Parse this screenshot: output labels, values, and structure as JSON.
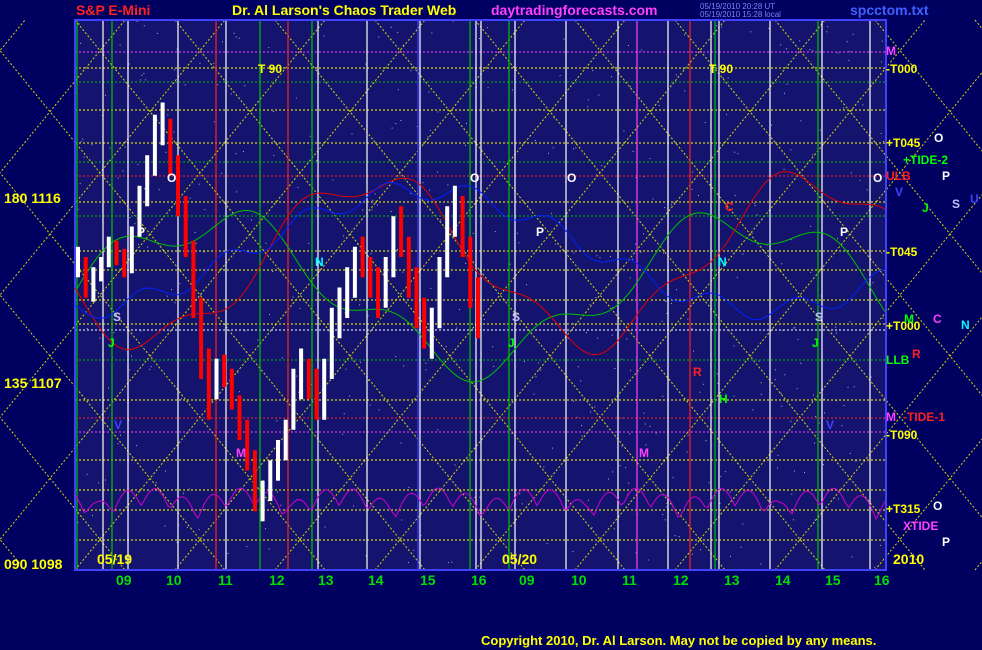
{
  "header": {
    "left": "S&P E-Mini",
    "center": "Dr. Al Larson's Chaos Trader Web",
    "site": "daytradingforecasts.com",
    "time1": "05/19/2010 20:28 UT",
    "time2": "05/19/2010 15:28 local",
    "file": "spcctom.txt"
  },
  "footer": {
    "copyright": "Copyright 2010, Dr. Al Larson. May not be copied by any means."
  },
  "colors": {
    "background": "#000060",
    "plot": "#14146e",
    "yellow": "#ffff00",
    "green": "#00c000",
    "red": "#ff0000",
    "magenta": "#ff00ff",
    "white": "#ffffff",
    "blue": "#4040ff"
  },
  "y_axis": [
    {
      "label": "180 1116",
      "value": 1116
    },
    {
      "label": "135 1107",
      "value": 1107
    },
    {
      "label": "090 1098",
      "value": 1098
    }
  ],
  "x_axis": {
    "date_labels": [
      "05/19",
      "05/20"
    ],
    "year": "2010",
    "hours": [
      "09",
      "10",
      "11",
      "12",
      "13",
      "14",
      "15",
      "16",
      "09",
      "10",
      "11",
      "12",
      "13",
      "14",
      "15",
      "16"
    ]
  },
  "t90_labels": [
    "T 90",
    "T 90"
  ],
  "right_labels": {
    "T000_top": "-T000",
    "T045p": "+T045",
    "tide2": "+TIDE-2",
    "ulb": "ULB",
    "T045m": "-T045",
    "T000p": "+T000",
    "llb": "LLB",
    "tide1": "-TIDE-1",
    "T090": "-T090",
    "T315": "+T315",
    "xtide": "XTIDE"
  },
  "planet_labels": {
    "M_top": "M",
    "O1": "O",
    "O2": "O",
    "P1": "P",
    "V": "V",
    "J": "J",
    "S": "S",
    "U": "U",
    "M_mid": "M",
    "C": "C",
    "N": "N",
    "R": "R",
    "M_low": "M",
    "O3": "O",
    "P2": "P"
  },
  "chart_letters": {
    "O_a": "O",
    "P_a": "P",
    "S_a": "S",
    "J_a": "J",
    "V_a": "V",
    "M_a": "M",
    "O_b": "O",
    "O_c": "O",
    "P_b": "P",
    "S_b": "S",
    "J_b": "J",
    "C_b": "C",
    "N_b": "N",
    "R_b": "R",
    "H_b": "H",
    "M_b": "M",
    "N_c": "N",
    "P_c": "P",
    "S_c": "S",
    "J_c": "J",
    "V_c": "V"
  },
  "chart_data": {
    "type": "bar",
    "title": "S&P E-Mini",
    "ylim": [
      1098,
      1122
    ],
    "series": [
      {
        "name": "05/19",
        "color_up": "#ffffff",
        "color_down": "#ff0000",
        "hlc": [
          [
            1113.5,
            1112.0,
            1112.8
          ],
          [
            1113.0,
            1111.0,
            1111.5
          ],
          [
            1112.5,
            1110.8,
            1112.2
          ],
          [
            1113.0,
            1111.8,
            1112.6
          ],
          [
            1114.0,
            1112.5,
            1113.8
          ],
          [
            1113.8,
            1112.6,
            1113.0
          ],
          [
            1113.4,
            1112.0,
            1112.3
          ],
          [
            1114.5,
            1112.2,
            1114.2
          ],
          [
            1116.5,
            1114.0,
            1116.0
          ],
          [
            1118.0,
            1115.5,
            1117.5
          ],
          [
            1120.0,
            1117.0,
            1119.2
          ],
          [
            1120.6,
            1118.5,
            1119.5
          ],
          [
            1119.8,
            1117.0,
            1117.5
          ],
          [
            1118.0,
            1115.0,
            1115.5
          ],
          [
            1116.0,
            1113.0,
            1113.4
          ],
          [
            1113.8,
            1110.0,
            1110.6
          ],
          [
            1111.0,
            1107.0,
            1107.8
          ],
          [
            1108.5,
            1105.0,
            1106.0
          ],
          [
            1108.0,
            1106.0,
            1107.4
          ],
          [
            1108.2,
            1106.6,
            1107.0
          ],
          [
            1107.5,
            1105.5,
            1105.8
          ],
          [
            1106.2,
            1104.0,
            1104.6
          ],
          [
            1105.0,
            1102.5,
            1103.0
          ],
          [
            1103.5,
            1100.5,
            1101.2
          ],
          [
            1102.0,
            1100.0,
            1101.5
          ],
          [
            1103.0,
            1101.0,
            1102.6
          ],
          [
            1104.0,
            1102.0,
            1103.5
          ],
          [
            1105.0,
            1103.0,
            1104.6
          ],
          [
            1107.5,
            1104.5,
            1107.0
          ],
          [
            1108.5,
            1106.0,
            1107.8
          ],
          [
            1108.0,
            1106.0,
            1106.8
          ],
          [
            1107.5,
            1105.0,
            1105.6
          ],
          [
            1108.0,
            1105.0,
            1107.4
          ],
          [
            1110.5,
            1107.0,
            1110.0
          ],
          [
            1111.5,
            1109.0,
            1110.6
          ],
          [
            1112.5,
            1110.0,
            1112.0
          ],
          [
            1113.5,
            1111.0,
            1113.0
          ],
          [
            1114.0,
            1112.0,
            1112.5
          ],
          [
            1113.0,
            1111.0,
            1111.6
          ],
          [
            1112.5,
            1110.0,
            1110.8
          ],
          [
            1113.0,
            1110.5,
            1112.4
          ],
          [
            1115.0,
            1112.0,
            1114.6
          ],
          [
            1115.5,
            1113.0,
            1113.6
          ],
          [
            1114.0,
            1111.0,
            1111.8
          ],
          [
            1112.5,
            1109.5,
            1110.2
          ],
          [
            1111.0,
            1108.5,
            1109.0
          ],
          [
            1110.5,
            1108.0,
            1110.0
          ],
          [
            1113.0,
            1109.5,
            1112.6
          ],
          [
            1115.5,
            1112.0,
            1115.0
          ],
          [
            1116.5,
            1114.0,
            1115.2
          ],
          [
            1116.0,
            1113.0,
            1113.6
          ],
          [
            1114.0,
            1110.5,
            1111.0
          ],
          [
            1112.0,
            1109.0,
            1110.4
          ]
        ]
      }
    ]
  }
}
